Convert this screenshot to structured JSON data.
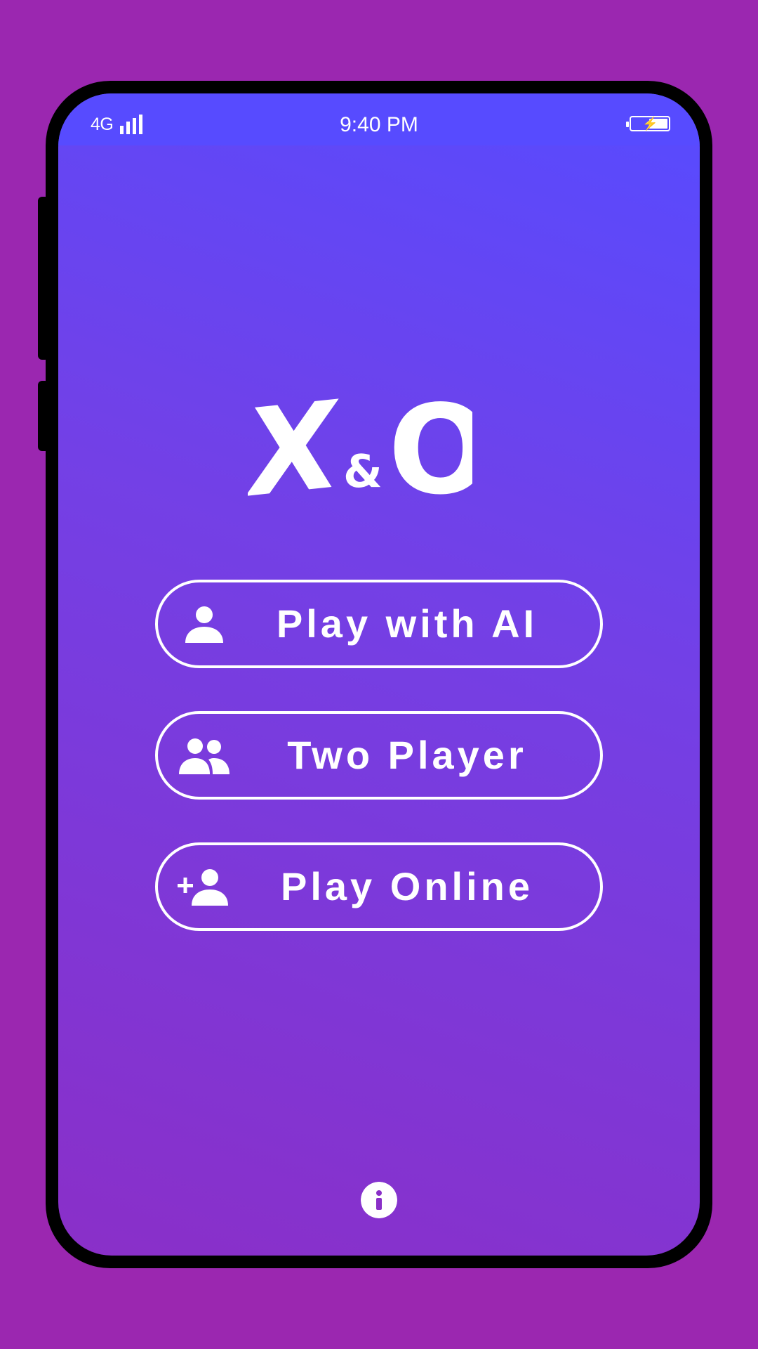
{
  "status_bar": {
    "network": "4G",
    "time": "9:40 PM",
    "signal_icon": "signal-bars-icon",
    "battery_icon": "battery-charging-icon"
  },
  "logo": {
    "x": "X",
    "amp": "&",
    "o": "O"
  },
  "menu": {
    "play_ai": {
      "label": "Play with AI",
      "icon": "person-icon"
    },
    "two_player": {
      "label": "Two Player",
      "icon": "group-icon"
    },
    "play_online": {
      "label": "Play Online",
      "icon": "person-add-icon"
    }
  },
  "info": {
    "icon": "info-icon"
  },
  "colors": {
    "background": "#9b27b0",
    "gradient_top": "#574bff",
    "gradient_bottom": "#8a2fc8",
    "foreground": "#ffffff"
  }
}
